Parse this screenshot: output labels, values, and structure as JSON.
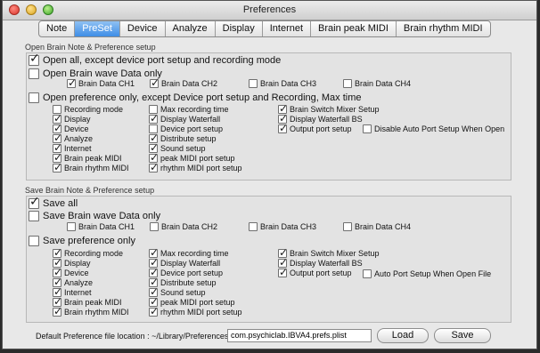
{
  "window": {
    "title": "Preferences"
  },
  "tabs": [
    {
      "label": "Note"
    },
    {
      "label": "PreSet"
    },
    {
      "label": "Device"
    },
    {
      "label": "Analyze"
    },
    {
      "label": "Display"
    },
    {
      "label": "Internet"
    },
    {
      "label": "Brain peak MIDI"
    },
    {
      "label": "Brain rhythm MIDI"
    }
  ],
  "active_tab": "PreSet",
  "open_section": {
    "title": "Open Brain Note & Preference setup",
    "open_all": {
      "label": "Open all, except device port setup and recording mode",
      "checked": true
    },
    "wave_only": {
      "label": "Open Brain wave Data only",
      "checked": false
    },
    "channels": [
      {
        "label": "Brain Data CH1",
        "checked": true
      },
      {
        "label": "Brain Data CH2",
        "checked": true
      },
      {
        "label": "Brain Data CH3",
        "checked": false
      },
      {
        "label": "Brain Data CH4",
        "checked": false
      }
    ],
    "pref_only": {
      "label": "Open preference only, except Device port setup and Recording, Max time",
      "checked": false
    },
    "col1": [
      {
        "label": "Recording mode",
        "checked": false
      },
      {
        "label": "Display",
        "checked": true
      },
      {
        "label": "Device",
        "checked": true
      },
      {
        "label": "Analyze",
        "checked": true
      },
      {
        "label": "Internet",
        "checked": true
      },
      {
        "label": "Brain peak MIDI",
        "checked": true
      },
      {
        "label": "Brain rhythm MIDI",
        "checked": true
      }
    ],
    "col2": [
      {
        "label": "Max recording time",
        "checked": false
      },
      {
        "label": "Display Waterfall",
        "checked": true
      },
      {
        "label": "Device port setup",
        "checked": false
      },
      {
        "label": "Distribute setup",
        "checked": true
      },
      {
        "label": "Sound setup",
        "checked": true
      },
      {
        "label": "peak MIDI port setup",
        "checked": true
      },
      {
        "label": "rhythm MIDI port setup",
        "checked": true
      }
    ],
    "col3": [
      {
        "label": "Brain Switch Mixer Setup",
        "checked": true
      },
      {
        "label": "Display Waterfall BS",
        "checked": true
      },
      {
        "label": "Output port setup",
        "checked": true
      }
    ],
    "auto_port": {
      "label": "Disable Auto Port Setup When Open",
      "checked": false
    }
  },
  "save_section": {
    "title": "Save Brain Note & Preference setup",
    "save_all": {
      "label": "Save all",
      "checked": true
    },
    "wave_only": {
      "label": "Save Brain wave Data only",
      "checked": false
    },
    "channels": [
      {
        "label": "Brain Data CH1",
        "checked": false
      },
      {
        "label": "Brain Data CH2",
        "checked": false
      },
      {
        "label": "Brain Data CH3",
        "checked": false
      },
      {
        "label": "Brain Data CH4",
        "checked": false
      }
    ],
    "pref_only": {
      "label": "Save preference only",
      "checked": false
    },
    "col1": [
      {
        "label": "Recording mode",
        "checked": true
      },
      {
        "label": "Display",
        "checked": true
      },
      {
        "label": "Device",
        "checked": true
      },
      {
        "label": "Analyze",
        "checked": true
      },
      {
        "label": "Internet",
        "checked": true
      },
      {
        "label": "Brain peak MIDI",
        "checked": true
      },
      {
        "label": "Brain rhythm MIDI",
        "checked": true
      }
    ],
    "col2": [
      {
        "label": "Max recording time",
        "checked": true
      },
      {
        "label": "Display Waterfall",
        "checked": true
      },
      {
        "label": "Device port setup",
        "checked": true
      },
      {
        "label": "Distribute setup",
        "checked": true
      },
      {
        "label": "Sound setup",
        "checked": true
      },
      {
        "label": "peak MIDI port setup",
        "checked": true
      },
      {
        "label": "rhythm MIDI port setup",
        "checked": true
      }
    ],
    "col3": [
      {
        "label": "Brain Switch Mixer Setup",
        "checked": true
      },
      {
        "label": "Display Waterfall BS",
        "checked": true
      },
      {
        "label": "Output port setup",
        "checked": true
      }
    ],
    "auto_port": {
      "label": "Auto Port Setup When Open File",
      "checked": false
    }
  },
  "footer": {
    "location_label": "Default Preference file location : ~/Library/Preferences/",
    "filename": "com.psychiclab.IBVA4.prefs.plist",
    "load_label": "Load",
    "save_label": "Save"
  }
}
